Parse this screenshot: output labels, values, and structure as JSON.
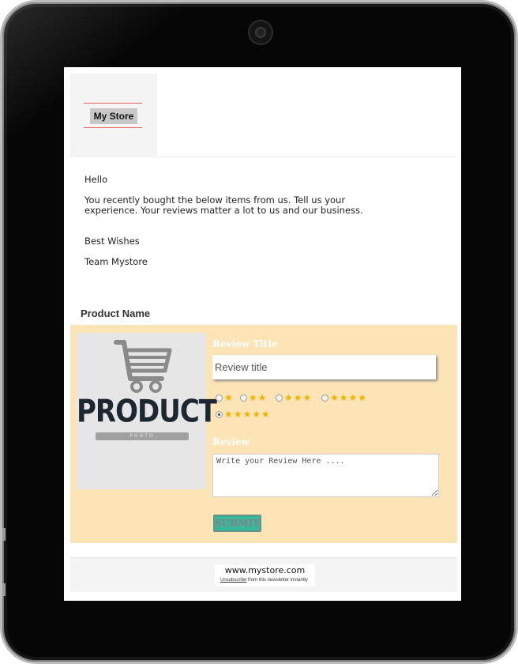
{
  "email": {
    "store_name": "My Store",
    "greeting": "Hello",
    "message": "You recently bought the below items from us. Tell us your experience. Your reviews matter a lot to us and our business.",
    "closing": "Best Wishes",
    "signature": "Team Mystore",
    "product_name": "Product Name",
    "product_image": {
      "word": "PRODUCT",
      "sub": "PHOTO",
      "icon": "shopping-cart-icon"
    },
    "review_form": {
      "title_label": "Review Title",
      "title_placeholder": "Review title",
      "ratings": [
        {
          "stars": "★",
          "value": 1,
          "selected": false
        },
        {
          "stars": "★★",
          "value": 2,
          "selected": false
        },
        {
          "stars": "★★★",
          "value": 3,
          "selected": false
        },
        {
          "stars": "★★★★",
          "value": 4,
          "selected": false
        },
        {
          "stars": "★★★★★",
          "value": 5,
          "selected": true
        }
      ],
      "review_label": "Review",
      "review_placeholder": "Write your Review Here ....",
      "submit_label": "SUBMIT"
    },
    "footer": {
      "url": "www.mystore.com",
      "unsubscribe_link": "Unsubscribe",
      "unsubscribe_rest": " from this newsletter instantly"
    }
  },
  "colors": {
    "panel_bg": "#fce4b6",
    "star": "#f0b400",
    "submit_bg": "#36b89a",
    "logo_border": "#e06666"
  }
}
